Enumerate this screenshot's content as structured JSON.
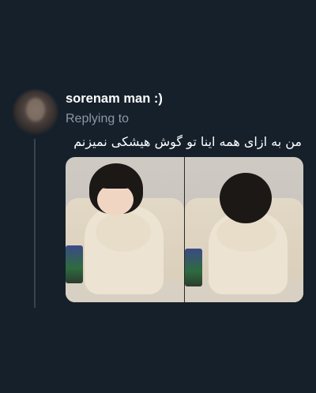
{
  "tweet": {
    "author_name": "sorenam man :)",
    "replying_to": "Replying to",
    "text": "من به ازای همه اینا تو گوش هیشکی نمیزنم"
  },
  "media": {
    "photos": [
      {
        "description_name": "photo-left"
      },
      {
        "description_name": "photo-right"
      }
    ]
  },
  "colors": {
    "background": "#15202b",
    "secondary_text": "#8b98a5",
    "thread_line": "#38444d"
  }
}
